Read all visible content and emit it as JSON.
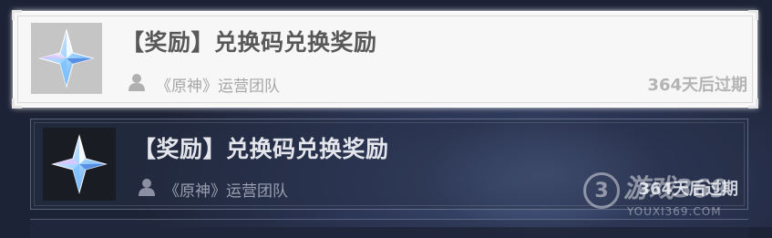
{
  "mail_list": [
    {
      "title": "【奖励】兑换码兑换奖励",
      "sender": "《原神》运营团队",
      "expiry": "364天后过期",
      "icon": "primogem-icon",
      "selected": true
    },
    {
      "title": "【奖励】兑换码兑换奖励",
      "sender": "《原神》运营团队",
      "expiry": "364天后过期",
      "icon": "primogem-icon",
      "selected": false
    }
  ],
  "watermark": {
    "logo_char": "3",
    "text": "游戏369",
    "url": "YOUXI369.COM"
  },
  "colors": {
    "selected_bg": "#f7f7f7",
    "dark_card_bg": "#283048",
    "background": "#2c3656"
  }
}
